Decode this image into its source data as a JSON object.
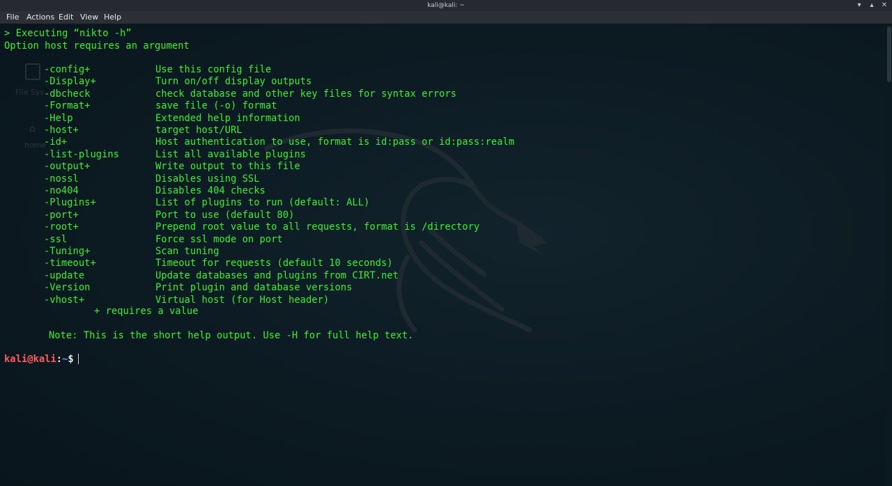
{
  "window": {
    "title": "kali@kali: ~",
    "controls": {
      "minimize_icon": "▾",
      "maximize_icon": "▴",
      "close_icon": "✕"
    }
  },
  "menu": [
    "File",
    "Actions",
    "Edit",
    "View",
    "Help"
  ],
  "desktop": {
    "filesystem_label": "File Sys",
    "home_label": "home"
  },
  "terminal": {
    "header_lines": [
      "> Executing “nikto -h”",
      "Option host requires an argument"
    ],
    "options": [
      {
        "flag": "-config+",
        "desc": "Use this config file"
      },
      {
        "flag": "-Display+",
        "desc": "Turn on/off display outputs"
      },
      {
        "flag": "-dbcheck",
        "desc": "check database and other key files for syntax errors"
      },
      {
        "flag": "-Format+",
        "desc": "save file (-o) format"
      },
      {
        "flag": "-Help",
        "desc": "Extended help information"
      },
      {
        "flag": "-host+",
        "desc": "target host/URL"
      },
      {
        "flag": "-id+",
        "desc": "Host authentication to use, format is id:pass or id:pass:realm"
      },
      {
        "flag": "-list-plugins",
        "desc": "List all available plugins"
      },
      {
        "flag": "-output+",
        "desc": "Write output to this file"
      },
      {
        "flag": "-nossl",
        "desc": "Disables using SSL"
      },
      {
        "flag": "-no404",
        "desc": "Disables 404 checks"
      },
      {
        "flag": "-Plugins+",
        "desc": "List of plugins to run (default: ALL)"
      },
      {
        "flag": "-port+",
        "desc": "Port to use (default 80)"
      },
      {
        "flag": "-root+",
        "desc": "Prepend root value to all requests, format is /directory"
      },
      {
        "flag": "-ssl",
        "desc": "Force ssl mode on port"
      },
      {
        "flag": "-Tuning+",
        "desc": "Scan tuning"
      },
      {
        "flag": "-timeout+",
        "desc": "Timeout for requests (default 10 seconds)"
      },
      {
        "flag": "-update",
        "desc": "Update databases and plugins from CIRT.net"
      },
      {
        "flag": "-Version",
        "desc": "Print plugin and database versions"
      },
      {
        "flag": "-vhost+",
        "desc": "Virtual host (for Host header)"
      }
    ],
    "requires_note": "+ requires a value",
    "short_help_note": "Note: This is the short help output. Use -H for full help text.",
    "prompt": {
      "user_host": "kali@kali",
      "separator": ":",
      "path": "~",
      "symbol": "$"
    }
  },
  "colors": {
    "output_text": "#2ff22f",
    "prompt_user": "#ff5b5b",
    "prompt_path": "#5b9bff",
    "background": "#0b1921"
  }
}
